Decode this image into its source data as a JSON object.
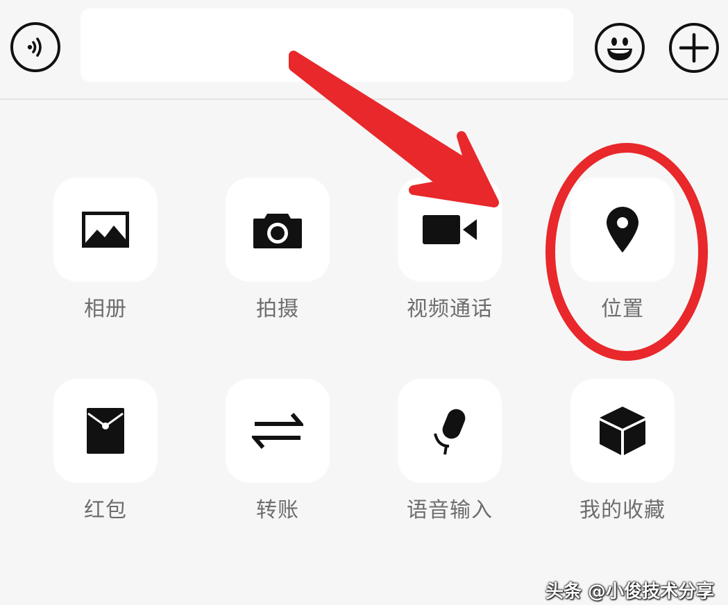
{
  "input_bar": {
    "voice_icon": "voice-icon",
    "text_value": "",
    "emoji_icon": "emoji-icon",
    "more_icon": "plus-icon"
  },
  "panel": {
    "items": [
      {
        "label": "相册",
        "icon": "image-icon"
      },
      {
        "label": "拍摄",
        "icon": "camera-icon"
      },
      {
        "label": "视频通话",
        "icon": "video-call-icon"
      },
      {
        "label": "位置",
        "icon": "location-pin-icon"
      },
      {
        "label": "红包",
        "icon": "red-packet-icon"
      },
      {
        "label": "转账",
        "icon": "transfer-icon"
      },
      {
        "label": "语音输入",
        "icon": "microphone-icon"
      },
      {
        "label": "我的收藏",
        "icon": "favorites-cube-icon"
      }
    ]
  },
  "annotations": {
    "arrow_color": "#e8282b",
    "circle_color": "#e8282b"
  },
  "watermark": "头条 @小俊技术分享"
}
